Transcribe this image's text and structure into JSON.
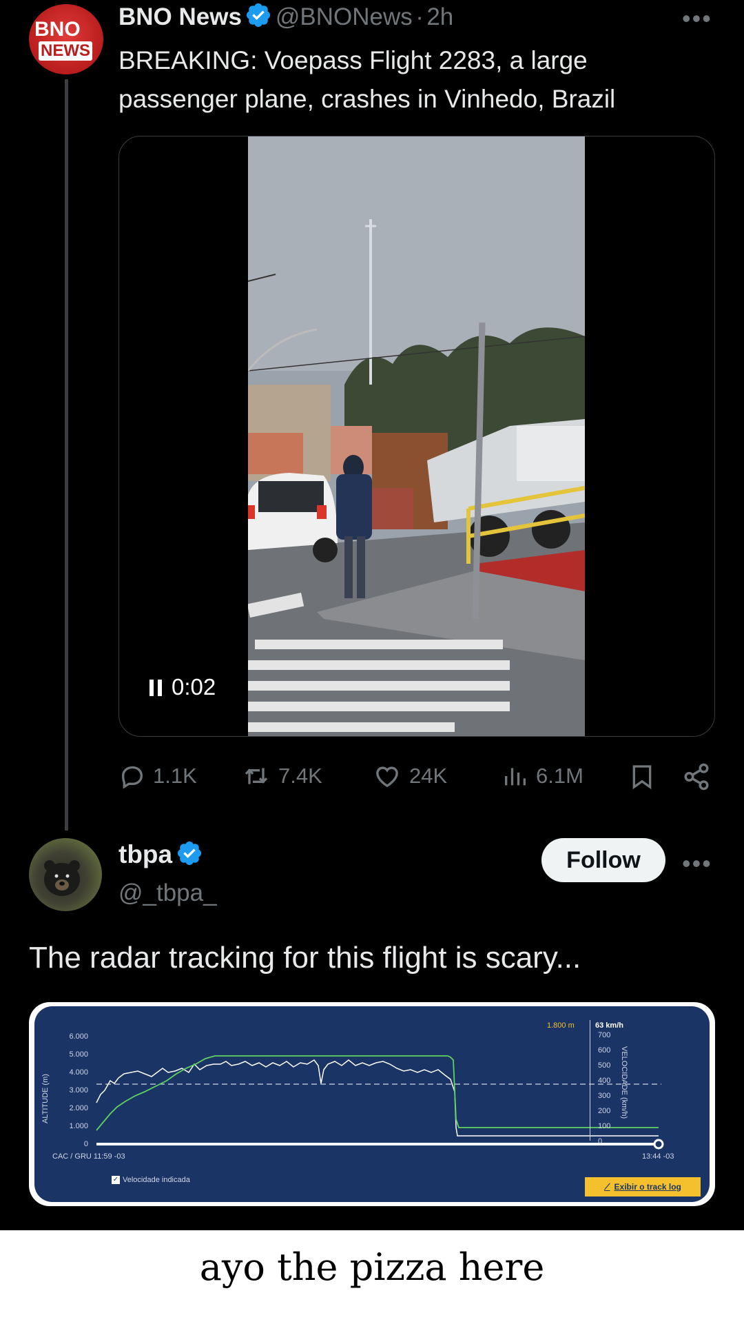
{
  "tweet1": {
    "avatar_text_top": "BNO",
    "avatar_text_bottom": "NEWS",
    "name": "BNO News",
    "handle": "@BNONews",
    "separator": "·",
    "time": "2h",
    "more": "•••",
    "text_line1": "BREAKING: Voepass Flight 2283, a large",
    "text_line2": "passenger plane, crashes in Vinhedo, Brazil",
    "video_time": "0:02",
    "stats": {
      "replies": "1.1K",
      "reposts": "7.4K",
      "likes": "24K",
      "views": "6.1M"
    }
  },
  "tweet2": {
    "name": "tbpa",
    "handle": "@_tbpa_",
    "follow_label": "Follow",
    "more": "•••",
    "text": "The radar tracking for this flight is scary..."
  },
  "radar": {
    "y_axis_label": "ALTITUDE (m)",
    "y_ticks": [
      "6.000",
      "5.000",
      "4.000",
      "3.000",
      "2.000",
      "1.000",
      "0"
    ],
    "right_axis_label": "VELOCIDADE (km/h)",
    "right_ticks": [
      "700",
      "600",
      "500",
      "400",
      "300",
      "200",
      "100",
      "0"
    ],
    "current_altitude": "1.800 m",
    "current_speed": "63 km/h",
    "start_label": "CAC / GRU 11:59 -03",
    "end_label": "13:44 -03",
    "checkbox_label": "Velocidade indicada",
    "button_label": "Exibir o track log"
  },
  "caption": "ayo the pizza here",
  "colors": {
    "background": "#000000",
    "verified": "#1d9bf0",
    "chart_bg": "#1a3465",
    "altitude_line": "#5fd35f",
    "speed_line": "#ffffff",
    "track_button": "#f4c02d"
  }
}
